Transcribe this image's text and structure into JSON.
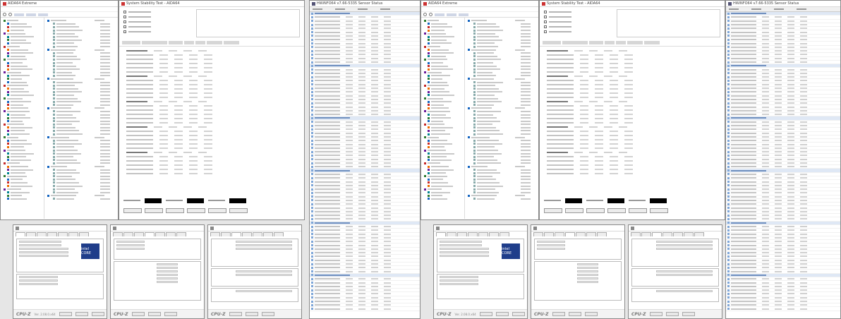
{
  "aida_title": "AIDA64 Extreme",
  "stability_title": "System Stability Test - AIDA64",
  "hwinfo_title": "HWiNFO64 v7.66-5335 Sensor Status",
  "cpuz_brand": "CPU-Z",
  "cpuz_version": "Ver. 2.08.0.x64",
  "cpuz_logo_left": "intel CORE",
  "cpuz_logo_right": "intel CORE",
  "colors": {
    "accent": "#1f3d8a",
    "aida_red": "#c33333",
    "hwinfo_header": "#dfe8f5",
    "timer_green": "#4be04b"
  }
}
